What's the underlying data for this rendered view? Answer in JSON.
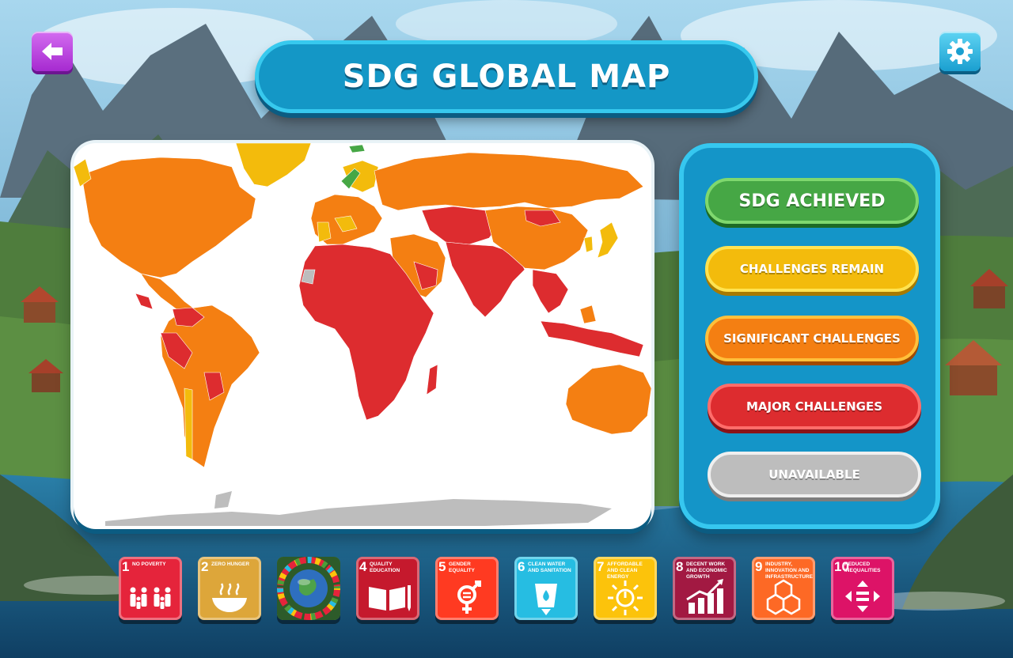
{
  "header": {
    "title": "SDG GLOBAL MAP"
  },
  "icons": {
    "back": "back-arrow-icon",
    "settings": "gear-icon"
  },
  "legend": {
    "items": [
      {
        "label": "SDG ACHIEVED",
        "color": "#46a745"
      },
      {
        "label": "CHALLENGES REMAIN",
        "color": "#f3bb0c"
      },
      {
        "label": "SIGNIFICANT CHALLENGES",
        "color": "#f47f12"
      },
      {
        "label": "MAJOR CHALLENGES",
        "color": "#dd2c2f"
      },
      {
        "label": "UNAVAILABLE",
        "color": "#bdbdbd"
      }
    ]
  },
  "map": {
    "regions": [
      {
        "name": "Greenland",
        "status": "challenges remain"
      },
      {
        "name": "North America",
        "status": "significant challenges"
      },
      {
        "name": "Central America",
        "status": "significant challenges"
      },
      {
        "name": "South America",
        "status": "significant challenges"
      },
      {
        "name": "Europe",
        "status": "significant challenges"
      },
      {
        "name": "Nordic countries",
        "status": "challenges remain"
      },
      {
        "name": "Russia",
        "status": "significant challenges"
      },
      {
        "name": "Africa",
        "status": "major challenges"
      },
      {
        "name": "Middle East",
        "status": "significant challenges"
      },
      {
        "name": "Central Asia",
        "status": "major challenges"
      },
      {
        "name": "South Asia",
        "status": "major challenges"
      },
      {
        "name": "China",
        "status": "significant challenges"
      },
      {
        "name": "Japan",
        "status": "challenges remain"
      },
      {
        "name": "Southeast Asia",
        "status": "major challenges"
      },
      {
        "name": "Australia",
        "status": "significant challenges"
      },
      {
        "name": "Antarctica",
        "status": "unavailable"
      }
    ]
  },
  "sdg_tiles": [
    {
      "number": "1",
      "label": "NO POVERTY",
      "color": "#e5243b",
      "icon": "family-icon"
    },
    {
      "number": "2",
      "label": "ZERO HUNGER",
      "color": "#dda63a",
      "icon": "food-bowl-icon"
    },
    {
      "number": "",
      "label": "",
      "color": "#1d6b2a",
      "icon": "sdg-globe-wheel-icon"
    },
    {
      "number": "4",
      "label": "QUALITY EDUCATION",
      "color": "#c5192d",
      "icon": "book-pencil-icon"
    },
    {
      "number": "5",
      "label": "GENDER EQUALITY",
      "color": "#ff3a21",
      "icon": "gender-equality-icon"
    },
    {
      "number": "6",
      "label": "CLEAN WATER AND SANITATION",
      "color": "#26bde2",
      "icon": "water-glass-icon"
    },
    {
      "number": "7",
      "label": "AFFORDABLE AND CLEAN ENERGY",
      "color": "#fcc30b",
      "icon": "sun-power-icon"
    },
    {
      "number": "8",
      "label": "DECENT WORK AND ECONOMIC GROWTH",
      "color": "#a21942",
      "icon": "growth-chart-icon"
    },
    {
      "number": "9",
      "label": "INDUSTRY, INNOVATION AND INFRASTRUCTURE",
      "color": "#fd6925",
      "icon": "cubes-icon"
    },
    {
      "number": "10",
      "label": "REDUCED INEQUALITIES",
      "color": "#dd1367",
      "icon": "equality-arrows-icon"
    }
  ]
}
